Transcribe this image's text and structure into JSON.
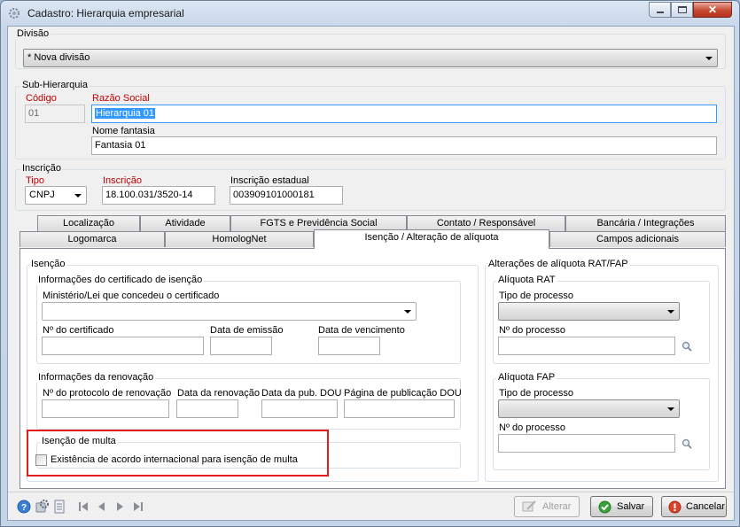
{
  "window": {
    "title": "Cadastro: Hierarquia empresarial",
    "close_glyph": "✕"
  },
  "divisao": {
    "group_label": "Divisão",
    "selected": "* Nova divisão"
  },
  "sub_hierarquia": {
    "group_label": "Sub-Hierarquia",
    "codigo_label": "Código",
    "codigo_value": "01",
    "razao_label": "Razão Social",
    "razao_value": "Hierarquia 01",
    "fantasia_label": "Nome fantasia",
    "fantasia_value": "Fantasia 01"
  },
  "inscricao": {
    "group_label": "Inscrição",
    "tipo_label": "Tipo",
    "tipo_value": "CNPJ",
    "inscricao_label": "Inscrição",
    "inscricao_value": "18.100.031/3520-14",
    "estadual_label": "Inscrição estadual",
    "estadual_value": "003909101000181"
  },
  "tabs": {
    "row1": [
      "Localização",
      "Atividade",
      "FGTS e Previdência Social",
      "Contato / Responsável",
      "Bancária / Integrações"
    ],
    "row2": [
      "Logomarca",
      "HomologNet",
      "Isenção / Alteração de alíquota",
      "Campos adicionais"
    ],
    "active": "Isenção / Alteração de alíquota"
  },
  "isencao": {
    "group_label": "Isenção",
    "certificado": {
      "group_label": "Informações do certificado de isenção",
      "ministerio_label": "Ministério/Lei que concedeu o certificado",
      "ministerio_value": "",
      "numero_label": "Nº do certificado",
      "emissao_label": "Data de emissão",
      "vencimento_label": "Data de vencimento"
    },
    "renovacao": {
      "group_label": "Informações da renovação",
      "protocolo_label": "Nº do protocolo de renovação",
      "data_renovacao_label": "Data da renovação",
      "data_pub_label": "Data da pub. DOU",
      "pagina_label": "Página de publicação DOU"
    },
    "multa": {
      "group_label": "Isenção de multa",
      "checkbox_label": "Existência de acordo internacional para isenção de multa",
      "checked": false
    }
  },
  "aliquota": {
    "group_label": "Alterações de alíquota RAT/FAP",
    "rat": {
      "group_label": "Alíquota RAT",
      "tipo_label": "Tipo de processo",
      "tipo_value": "",
      "numero_label": "Nº do processo",
      "numero_value": ""
    },
    "fap": {
      "group_label": "Alíquota FAP",
      "tipo_label": "Tipo de processo",
      "tipo_value": "",
      "numero_label": "Nº do processo",
      "numero_value": ""
    }
  },
  "buttons": {
    "alterar": "Alterar",
    "salvar": "Salvar",
    "cancelar": "Cancelar"
  },
  "icons": [
    "help-icon",
    "tools-icon",
    "report-icon",
    "first-record-icon",
    "previous-record-icon",
    "next-record-icon",
    "last-record-icon"
  ],
  "colors": {
    "highlight": "#e11d1d",
    "required_label": "#c00000",
    "selection": "#3399ff"
  }
}
